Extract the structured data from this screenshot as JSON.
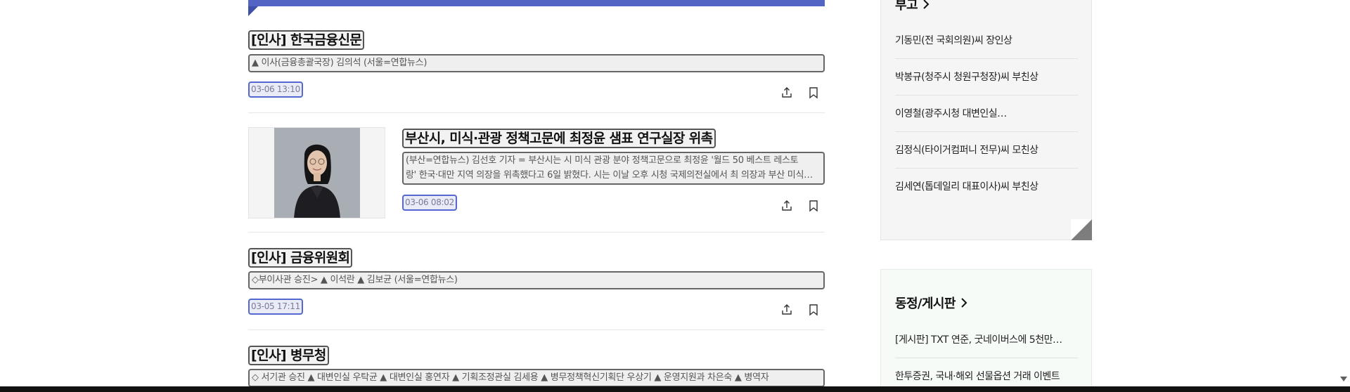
{
  "articles": [
    {
      "title": "[인사] 한국금융신문",
      "summary": [
        "▲ 이사(금융총괄국장) 김의석 (서울=연합뉴스)"
      ],
      "time": "03-06 13:10"
    },
    {
      "title": "부산시, 미식·관광 정책고문에 최정윤 샘표 연구실장 위촉",
      "summary": [
        "(부산=연합뉴스) 김선호 기자 = 부산시는 시 미식 관광 분야 정책고문으로 최정윤 '월드 50 베스트 레스토",
        "랑' 한국·대만 지역 의장을 위촉했다고 6일 밝혔다. 시는 이날 오후 시청 국제의전실에서 최 의장과 부산 미식…"
      ],
      "time": "03-06 08:02"
    },
    {
      "title": "[인사] 금융위원회",
      "summary": [
        "◇부이사관 승진> ▲ 이석란 ▲ 김보균 (서울=연합뉴스)"
      ],
      "time": "03-05 17:11"
    },
    {
      "title": "[인사] 병무청",
      "summary": [
        "◇ 서기관 승진 ▲ 대변인실 우탁균 ▲ 대변인실 홍연자 ▲ 기획조정관실 김세용 ▲ 병무정책혁신기획단 우상기 ▲ 운영지원과 차은숙 ▲ 병역자"
      ]
    }
  ],
  "sidebar": {
    "obituary": {
      "title": "부고",
      "items": [
        "기동민(전 국회의원)씨 장인상",
        "박봉규(청주시 청원구청장)씨 부친상",
        "이영철(광주시청 대변인실…",
        "김정식(타이거컴퍼니 전무)씨 모친상",
        "김세연(톱데일리 대표이사)씨 부친상"
      ]
    },
    "board": {
      "title": "동정/게시판",
      "items": [
        "[게시판] TXT 연준, 굿네이버스에 5천만…",
        "한투증권, 국내·해외 선물옵션 거래 이벤트"
      ]
    }
  },
  "icons": {
    "share": "share-icon",
    "bookmark": "bookmark-icon",
    "chevron": "chevron-right-icon"
  },
  "colors": {
    "accent": "#5264c4",
    "time_border": "#5567d0"
  }
}
